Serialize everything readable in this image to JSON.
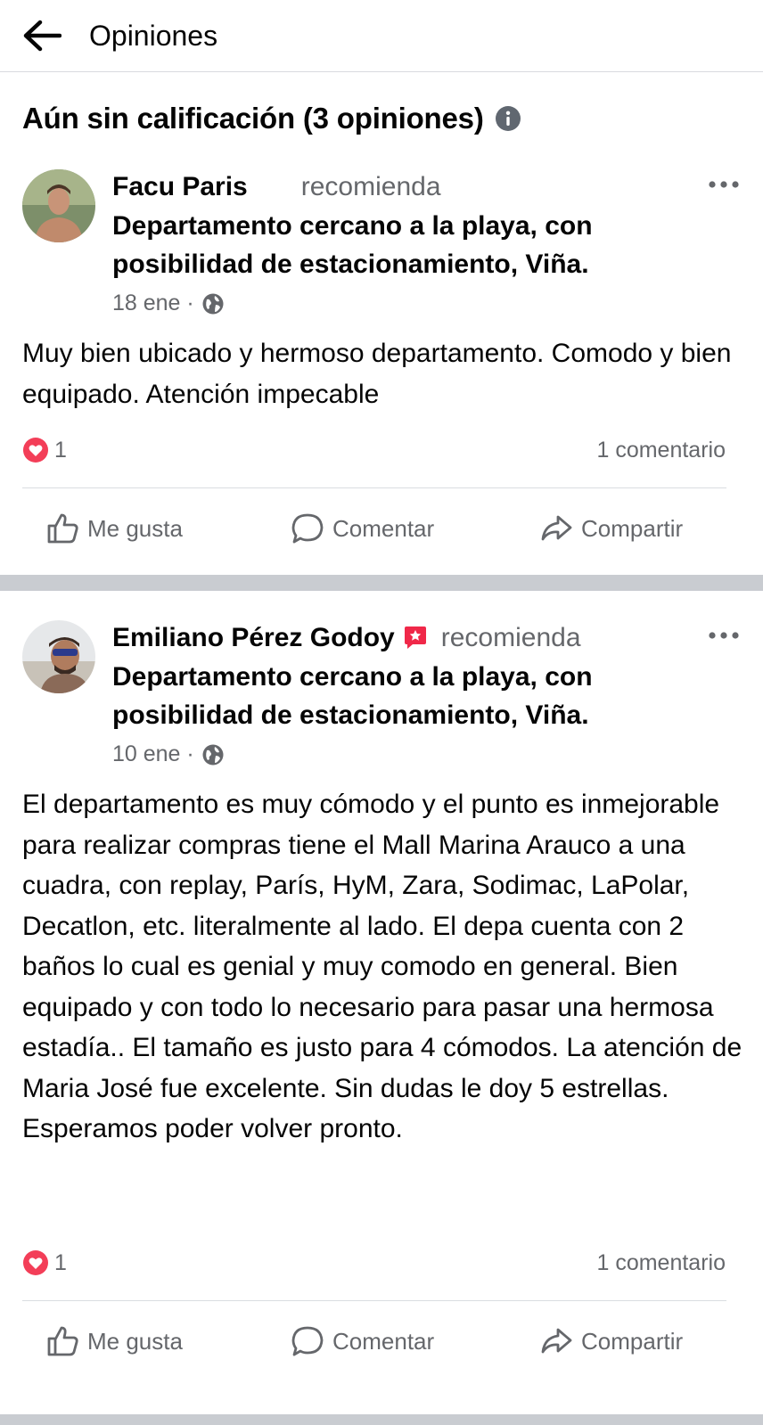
{
  "header": {
    "title": "Opiniones",
    "back_icon": "arrow-left-icon"
  },
  "summary": {
    "title": "Aún sin calificación (3 opiniones)",
    "info_icon": "info-icon"
  },
  "reviews": [
    {
      "author": "Facu Paris",
      "action": "recomienda",
      "place": "Departamento cercano a la playa, con posibilidad de estacionamiento, Viña",
      "date": "18 ene ·",
      "privacy_icon": "globe-icon",
      "text": "Muy bien ubicado y hermoso departamento. Comodo y bien equipado. Atención impecable",
      "reaction_count": "1",
      "comments": "1 comentario",
      "has_badge": false
    },
    {
      "author": "Emiliano Pérez Godoy",
      "action": "recomienda",
      "place": "Departamento cercano a la playa, con posibilidad de estacionamiento, Viña",
      "date": "10 ene ·",
      "privacy_icon": "globe-icon",
      "text": "El departamento es muy cómodo y el punto es inmejorable para realizar compras tiene el Mall Marina Arauco a una cuadra, con replay, París, HyM, Zara, Sodimac, LaPolar, Decatlon, etc. literalmente al lado. El depa cuenta con 2 baños lo cual es genial y muy comodo en general. Bien equipado y con todo lo necesario para pasar una hermosa estadía.. El tamaño es justo para 4 cómodos. La atención de Maria José fue excelente. Sin dudas le doy 5 estrellas. Esperamos poder volver pronto.",
      "reaction_count": "1",
      "comments": "1 comentario",
      "has_badge": true
    }
  ],
  "actions": {
    "like": "Me gusta",
    "comment": "Comentar",
    "share": "Compartir"
  },
  "colors": {
    "heart": "#e4405f",
    "secondary_text": "#65676b",
    "separator": "#c9ccd1",
    "badge": "#f02849"
  }
}
